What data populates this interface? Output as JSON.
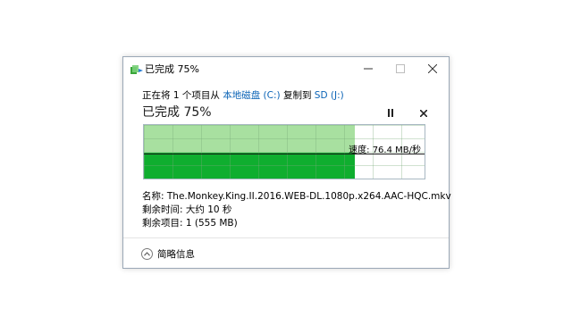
{
  "window": {
    "title": "已完成 75%",
    "progress_percent": 75
  },
  "copy": {
    "prefix": "正在将 1 个项目从 ",
    "source": "本地磁盘 (C:)",
    "middle": " 复制到 ",
    "destination": "SD (J:)",
    "heading": "已完成 75%"
  },
  "graph": {
    "speed_label": "速度: 76.4 MB/秒",
    "colors": {
      "progress": "#a8e0a0",
      "speed": "#0fae2f"
    }
  },
  "details": {
    "name": "名称: The.Monkey.King.II.2016.WEB-DL.1080p.x264.AAC-HQC.mkv",
    "time_left": "剩余时间: 大约 10 秒",
    "items_left": "剩余项目: 1 (555 MB)"
  },
  "footer": {
    "less_details_label": "简略信息"
  },
  "icons": [
    "copy-app-icon",
    "minimize-icon",
    "maximize-icon",
    "close-icon",
    "pause-icon",
    "stop-icon",
    "chevron-up-icon"
  ]
}
